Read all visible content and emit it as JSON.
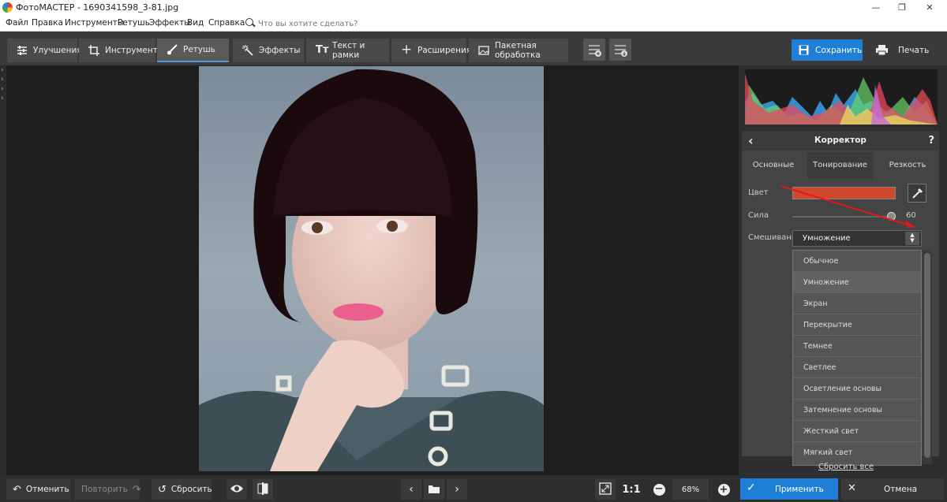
{
  "window": {
    "title": "ФотоМАСТЕР - 1690341598_3-81.jpg",
    "minimize": "—",
    "maximize": "❐",
    "close": "✕"
  },
  "menu": {
    "items": [
      "Файл",
      "Правка",
      "Инструменты",
      "Ретушь",
      "Эффекты",
      "Вид",
      "Справка"
    ],
    "search_placeholder": "Что вы хотите сделать?"
  },
  "toolbar": {
    "tabs": [
      "Улучшения",
      "Инструменты",
      "Ретушь",
      "Эффекты",
      "Текст и рамки",
      "Расширения",
      "Пакетная обработка"
    ],
    "active_tab": "Ретушь",
    "save_label": "Сохранить",
    "print_label": "Печать"
  },
  "side_arrows": [
    "›",
    "›",
    "›",
    "›"
  ],
  "corrector": {
    "title": "Корректор",
    "help": "?",
    "tabs": [
      "Основные",
      "Тонирование",
      "Резкость"
    ],
    "active_tab": "Тонирование",
    "color_label": "Цвет",
    "color_value": "#d0482c",
    "strength_label": "Сила",
    "strength_value": "60",
    "blend_label": "Смешивание",
    "blend_selected": "Умножение",
    "blend_options": [
      "Обычное",
      "Умножение",
      "Экран",
      "Перекрытие",
      "Темнее",
      "Светлее",
      "Осветление основы",
      "Затемнение основы",
      "Жесткий свет",
      "Мягкий свет"
    ],
    "reset_all": "Сбросить все"
  },
  "bottom": {
    "undo": "Отменить",
    "redo": "Повторить",
    "reset": "Сбросить",
    "ratio": "1:1",
    "zoom": "68%",
    "apply": "Применить",
    "cancel": "Отмена"
  },
  "colors": {
    "accent": "#1f7fd6",
    "swatch": "#d0482c"
  }
}
